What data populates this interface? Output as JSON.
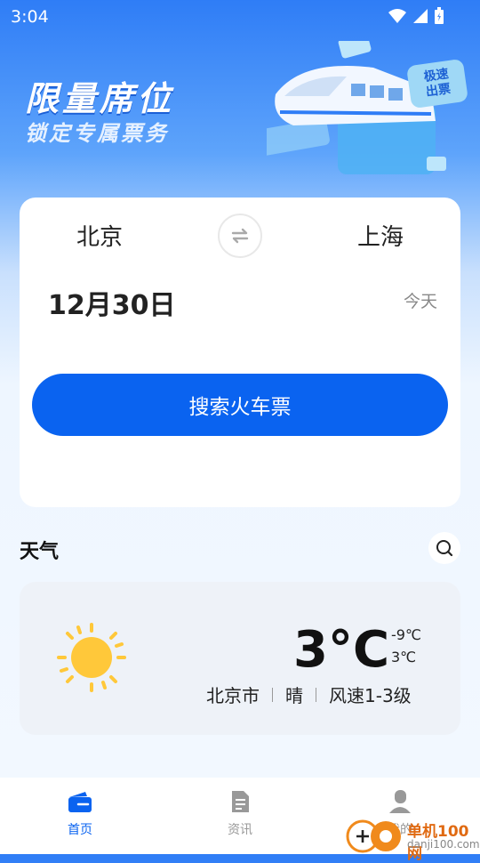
{
  "status_bar": {
    "time": "3:04"
  },
  "banner": {
    "title": "限量席位",
    "subtitle": "锁定专属票务",
    "stamp_line1": "极速",
    "stamp_line2": "出票"
  },
  "booking": {
    "from_city": "北京",
    "to_city": "上海",
    "date": "12月30日",
    "day_label": "今天",
    "search_label": "搜索火车票"
  },
  "weather": {
    "header": "天气",
    "temperature": "3°C",
    "low": "-9℃",
    "high": "3℃",
    "city": "北京市",
    "condition": "晴",
    "wind": "风速1-3级"
  },
  "tabs": [
    {
      "label": "首页",
      "active": true
    },
    {
      "label": "资讯",
      "active": false
    },
    {
      "label": "我的",
      "active": false
    }
  ],
  "watermark": {
    "text": "单机100网",
    "url_text": "danji100.com"
  },
  "colors": {
    "primary": "#0a63f0",
    "sun": "#ffc83a"
  }
}
